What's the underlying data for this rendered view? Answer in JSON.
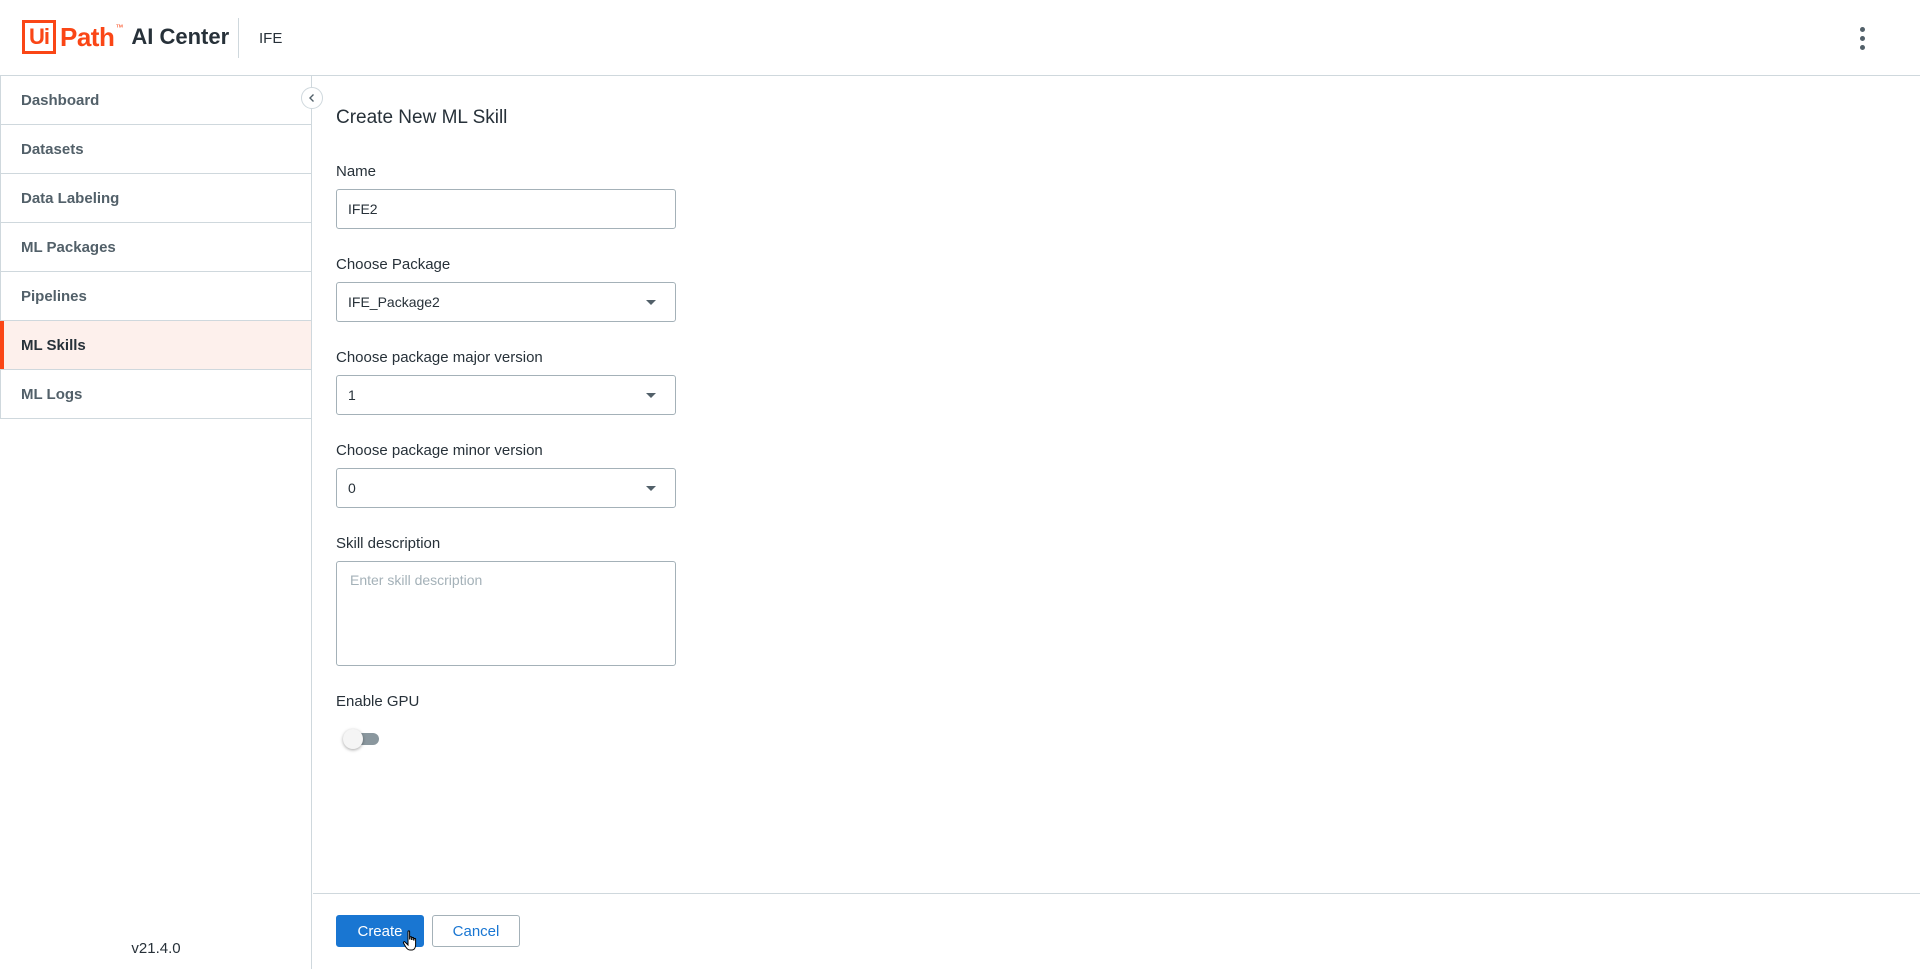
{
  "header": {
    "logo_box": "Ui",
    "logo_path": "Path",
    "logo_tm": "™",
    "product": "AI Center",
    "tenant": "IFE",
    "menu_icon": "more-vertical-icon"
  },
  "sidebar": {
    "items": [
      {
        "label": "Dashboard",
        "active": false
      },
      {
        "label": "Datasets",
        "active": false
      },
      {
        "label": "Data Labeling",
        "active": false
      },
      {
        "label": "ML Packages",
        "active": false
      },
      {
        "label": "Pipelines",
        "active": false
      },
      {
        "label": "ML Skills",
        "active": true
      },
      {
        "label": "ML Logs",
        "active": false
      }
    ],
    "version": "v21.4.0",
    "collapse_icon": "chevron-left-icon"
  },
  "form": {
    "title": "Create New ML Skill",
    "name_label": "Name",
    "name_value": "IFE2",
    "package_label": "Choose Package",
    "package_value": "IFE_Package2",
    "major_label": "Choose package major version",
    "major_value": "1",
    "minor_label": "Choose package minor version",
    "minor_value": "0",
    "description_label": "Skill description",
    "description_placeholder": "Enter skill description",
    "gpu_label": "Enable GPU",
    "gpu_enabled": false
  },
  "actions": {
    "create_label": "Create",
    "cancel_label": "Cancel"
  },
  "colors": {
    "brand": "#fa4616",
    "primary": "#1976d2",
    "active_nav_bg": "#fdf0ec"
  }
}
